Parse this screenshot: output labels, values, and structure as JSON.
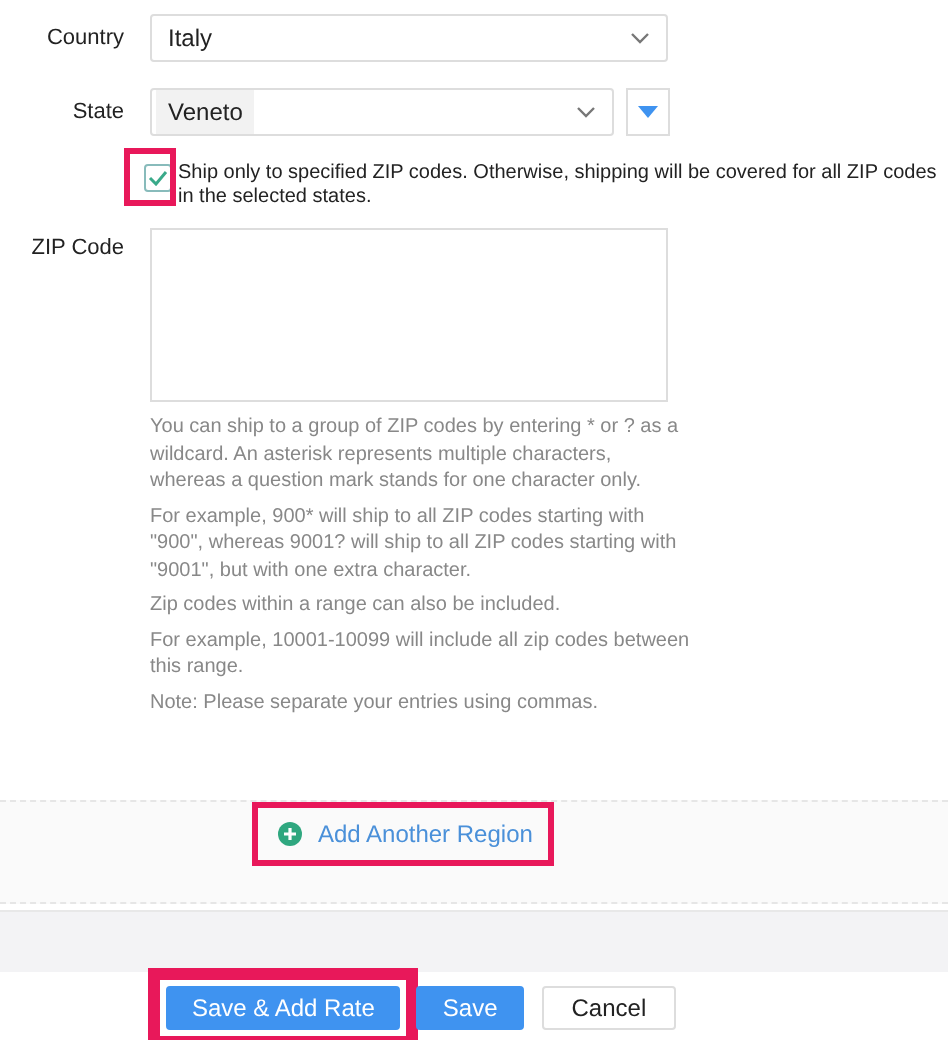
{
  "country": {
    "label": "Country",
    "value": "Italy"
  },
  "state": {
    "label": "State",
    "value": "Veneto"
  },
  "zip_restriction": {
    "label": "Ship only to specified ZIP codes. Otherwise, shipping will be covered for all ZIP codes in the selected states.",
    "checked": true,
    "highlighted": true
  },
  "zip_code": {
    "label": "ZIP Code"
  },
  "help_paragraphs": [
    "You can ship to a group of ZIP codes by entering * or ? as a wildcard. An asterisk represents multiple characters, whereas a question mark stands for one character only.",
    "For example, 900* will ship to all ZIP codes starting with \"900\", whereas 9001? will ship to all ZIP codes starting with \"9001\", but with one extra character.",
    "Zip codes within a range can also be included.",
    "For example, 10001-10099 will include all zip codes between this range.",
    "Note: Please separate your entries using commas."
  ],
  "add_region": {
    "label": "Add Another Region",
    "highlighted": true
  },
  "buttons": [
    {
      "label": "Save & Add Rate",
      "kind": "primary",
      "highlighted": true
    },
    {
      "label": "Save",
      "kind": "primary",
      "highlighted": false
    },
    {
      "label": "Cancel",
      "kind": "secondary",
      "highlighted": false
    }
  ]
}
